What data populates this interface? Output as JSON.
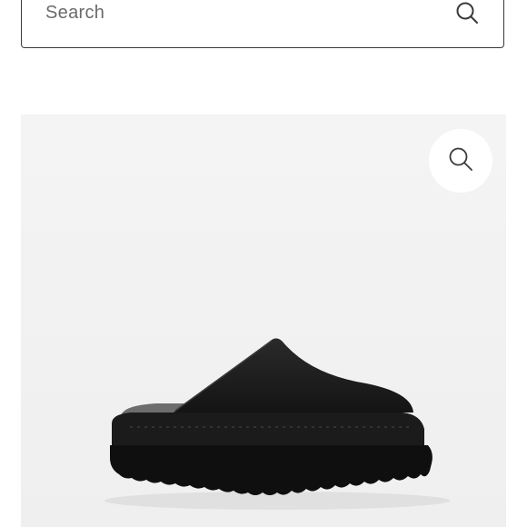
{
  "search": {
    "placeholder": "Search",
    "icon": "search-icon"
  },
  "product": {
    "image_subject": "black-platform-clog",
    "zoom_icon": "zoom-magnifier-icon"
  },
  "colors": {
    "border": "#3a3a3a",
    "text_muted": "#6b6b6b",
    "image_bg": "#f2f2f2",
    "product": "#151515"
  }
}
